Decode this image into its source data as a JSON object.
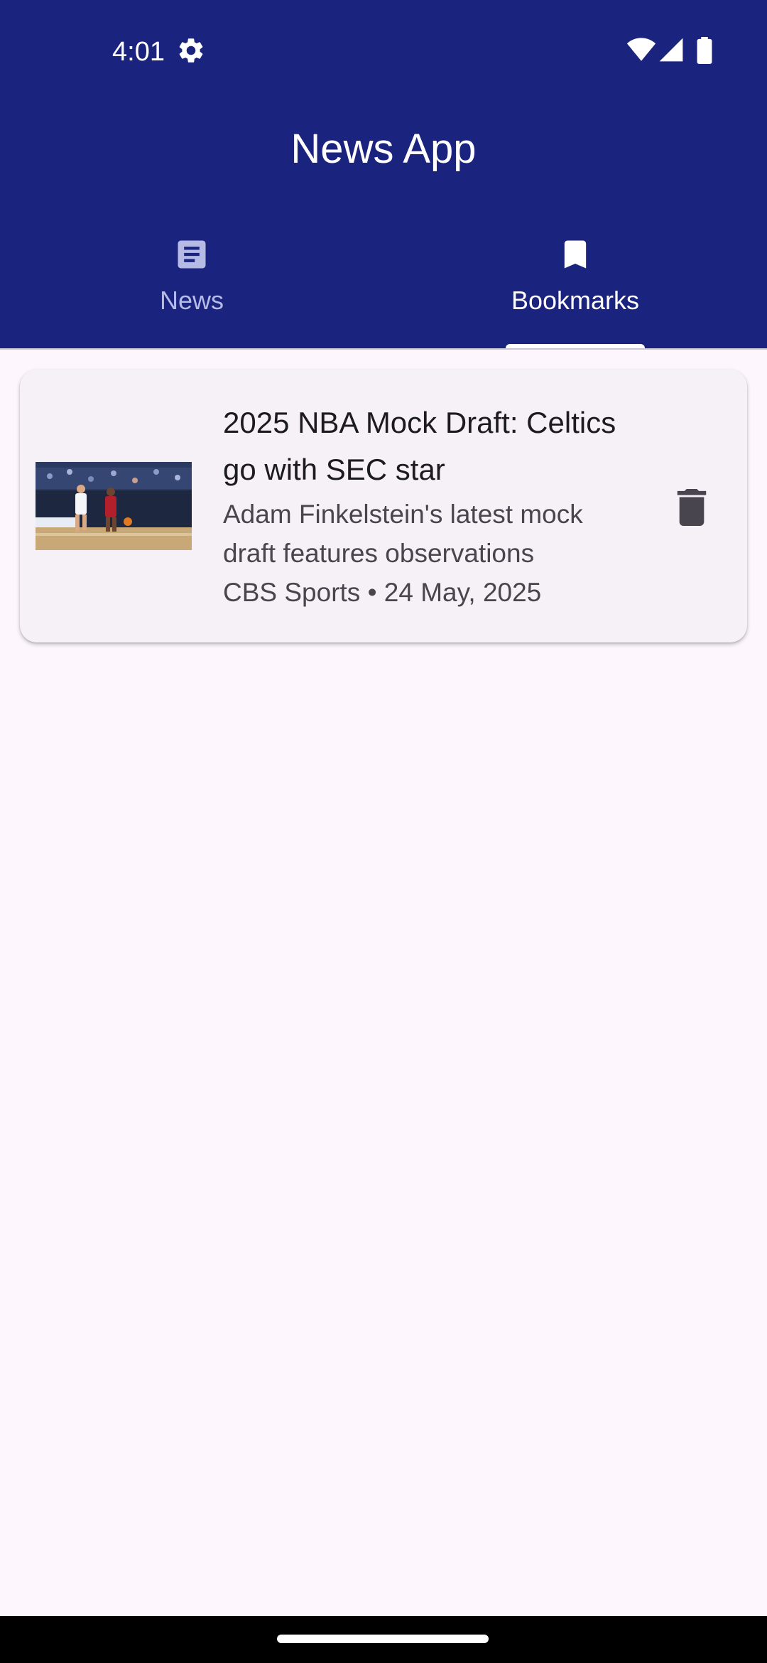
{
  "status_bar": {
    "time": "4:01",
    "icons": [
      "gear-icon",
      "wifi-icon",
      "signal-icon",
      "battery-icon"
    ]
  },
  "app_bar": {
    "title": "News App",
    "background_color": "#1A237E"
  },
  "tabs": [
    {
      "label": "News",
      "icon": "article-icon",
      "selected": false
    },
    {
      "label": "Bookmarks",
      "icon": "bookmark-icon",
      "selected": true
    }
  ],
  "bookmarks": [
    {
      "title": "2025 NBA Mock Draft: Celtics go with SEC star",
      "description": "Adam Finkelstein's latest mock draft features observations",
      "meta": "CBS Sports • 24 May, 2025",
      "thumbnail": "basketball-game-photo",
      "action_icon": "delete-icon"
    }
  ]
}
